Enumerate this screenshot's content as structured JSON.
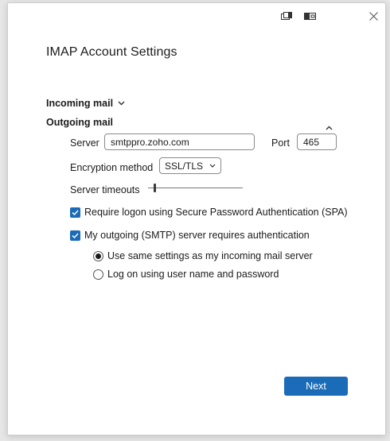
{
  "window": {
    "icons": [
      "restore-window-icon",
      "dock-window-icon",
      "close-icon"
    ]
  },
  "title": "IMAP Account Settings",
  "incoming": {
    "label": "Incoming mail",
    "expanded": false
  },
  "outgoing": {
    "label": "Outgoing mail",
    "expanded": true,
    "server_label": "Server",
    "server_value": "smtppro.zoho.com",
    "port_label": "Port",
    "port_value": "465",
    "encryption_label": "Encryption method",
    "encryption_value": "SSL/TLS",
    "timeouts_label": "Server timeouts",
    "timeouts_level": 0.07,
    "spa_label": "Require logon using Secure Password Authentication (SPA)",
    "spa_checked": true,
    "auth_label": "My outgoing (SMTP) server requires authentication",
    "auth_checked": true,
    "radio_same_label": "Use same settings as my incoming mail server",
    "radio_same_selected": true,
    "radio_logon_label": "Log on using user name and password",
    "radio_logon_selected": false
  },
  "actions": {
    "next_label": "Next"
  },
  "colors": {
    "accent": "#1a6bb8",
    "background": "#ffffff",
    "text": "#1b1b1b"
  }
}
